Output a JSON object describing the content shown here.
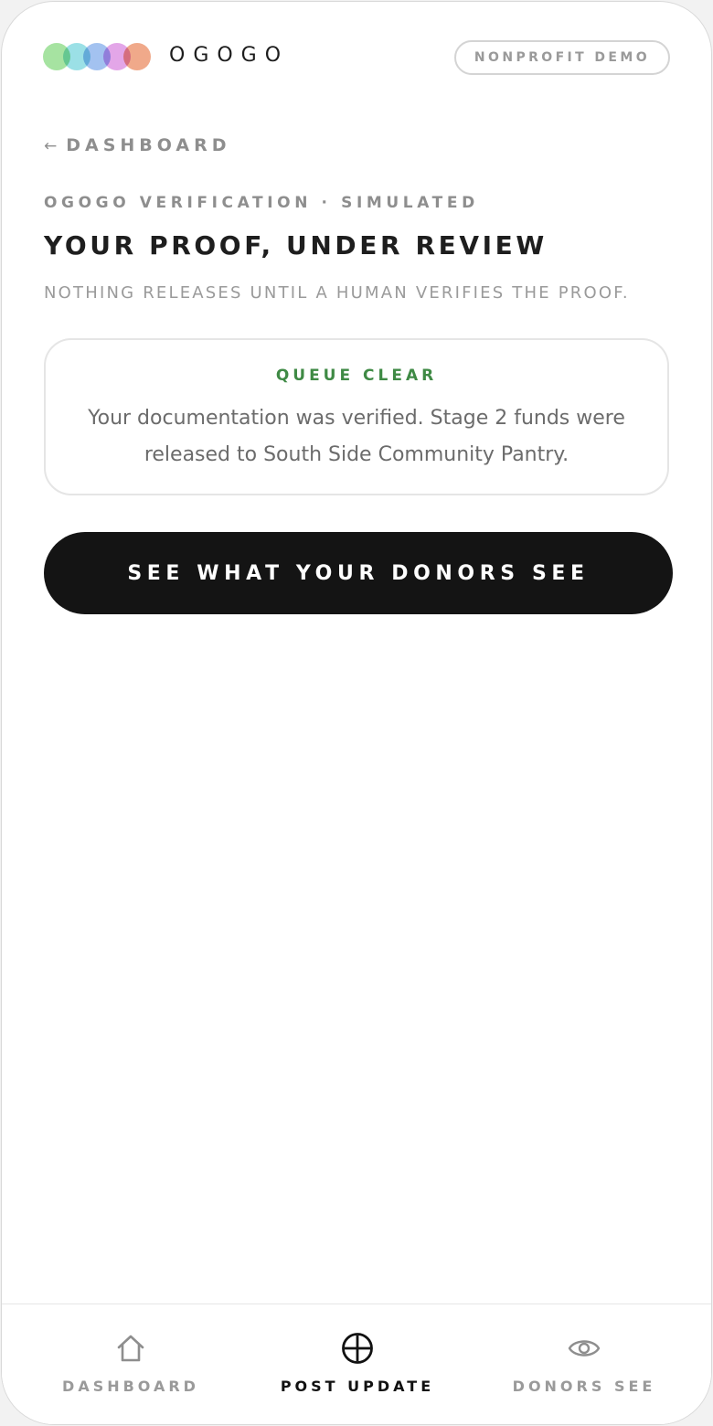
{
  "header": {
    "brand": "OGOGO",
    "badge": "NONPROFIT DEMO",
    "logo_colors": [
      "#a6e3a1",
      "#9be0e6",
      "#a3c2f0",
      "#e3a6e8",
      "#f0a98a"
    ]
  },
  "nav": {
    "back_arrow": "←",
    "back_label": "DASHBOARD"
  },
  "page": {
    "eyebrow": "OGOGO VERIFICATION · SIMULATED",
    "title": "YOUR PROOF, UNDER REVIEW",
    "subtitle": "NOTHING RELEASES UNTIL A HUMAN VERIFIES THE PROOF."
  },
  "status": {
    "label": "QUEUE CLEAR",
    "message": "Your documentation was verified. Stage 2 funds were released to South Side Community Pantry.",
    "label_color": "#3f8a45"
  },
  "cta": {
    "label": "SEE WHAT YOUR DONORS SEE"
  },
  "tabbar": {
    "tabs": [
      {
        "label": "DASHBOARD",
        "icon": "home-icon",
        "active": false
      },
      {
        "label": "POST UPDATE",
        "icon": "plus-circle-icon",
        "active": true
      },
      {
        "label": "DONORS SEE",
        "icon": "eye-icon",
        "active": false
      }
    ]
  }
}
